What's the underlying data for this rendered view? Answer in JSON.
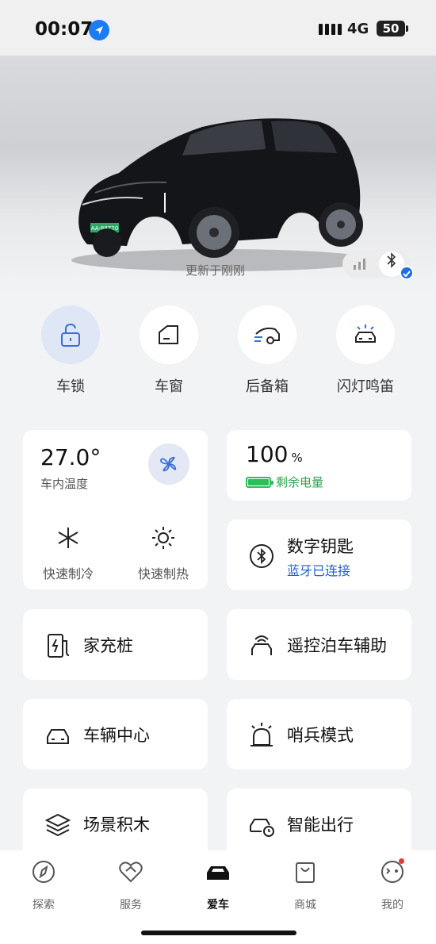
{
  "status_bar": {
    "time": "00:07",
    "network": "4G",
    "battery": "50"
  },
  "hero": {
    "update_text": "更新于刚刚",
    "plate": "AA-88720"
  },
  "quick_actions": [
    {
      "label": "车锁"
    },
    {
      "label": "车窗"
    },
    {
      "label": "后备箱"
    },
    {
      "label": "闪灯鸣笛"
    }
  ],
  "climate": {
    "temperature": "27.0°",
    "temp_label": "车内温度",
    "cool_label": "快速制冷",
    "heat_label": "快速制热"
  },
  "battery": {
    "value": "100",
    "unit": "%",
    "label": "剩余电量",
    "level": 1.0,
    "color": "#2dbd5a"
  },
  "digital_key": {
    "title": "数字钥匙",
    "status": "蓝牙已连接",
    "status_color": "#1f5fd0"
  },
  "tiles": {
    "home_charger": "家充桩",
    "remote_parking": "遥控泊车辅助",
    "vehicle_center": "车辆中心",
    "sentry_mode": "哨兵模式",
    "scene_blocks": "场景积木",
    "smart_travel": "智能出行"
  },
  "tabbar": [
    {
      "label": "探索",
      "icon": "compass-icon"
    },
    {
      "label": "服务",
      "icon": "heart-handshake-icon"
    },
    {
      "label": "爱车",
      "icon": "car-icon",
      "active": true
    },
    {
      "label": "商城",
      "icon": "shopping-bag-icon"
    },
    {
      "label": "我的",
      "icon": "profile-face-icon",
      "badge": true
    }
  ]
}
